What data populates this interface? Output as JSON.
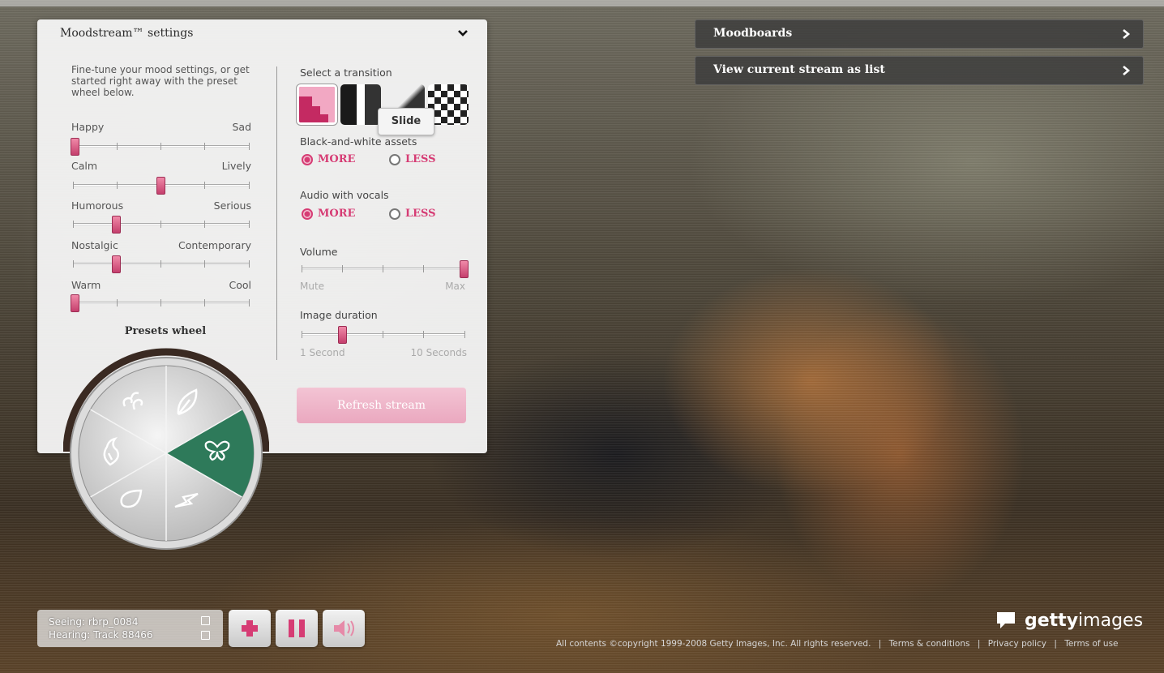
{
  "panel": {
    "title": "Moodstream™ settings",
    "intro": "Fine-tune your mood settings, or get started right away with the preset wheel below.",
    "sliders": [
      {
        "left": "Happy",
        "right": "Sad",
        "value": 0
      },
      {
        "left": "Calm",
        "right": "Lively",
        "value": 0.5
      },
      {
        "left": "Humorous",
        "right": "Serious",
        "value": 0.25
      },
      {
        "left": "Nostalgic",
        "right": "Contemporary",
        "value": 0.25
      },
      {
        "left": "Warm",
        "right": "Cool",
        "value": 0
      }
    ],
    "presets_title": "Presets wheel",
    "transition_label": "Select a transition",
    "transition_tooltip": "Slide",
    "bw_label": "Black-and-white assets",
    "audio_label": "Audio with vocals",
    "more_label": "MORE",
    "less_label": "LESS",
    "volume_label": "Volume",
    "volume_min": "Mute",
    "volume_max": "Max",
    "volume_value": 1,
    "duration_label": "Image duration",
    "duration_min": "1 Second",
    "duration_max": "10 Seconds",
    "duration_value": 0.25,
    "refresh_label": "Refresh stream"
  },
  "menu": {
    "moodboards": "Moodboards",
    "view_list": "View current stream as list"
  },
  "status": {
    "seeing_label": "Seeing:",
    "seeing_value": "rbrp_0084",
    "hearing_label": "Hearing:",
    "hearing_value": "Track 88466"
  },
  "brand": {
    "logo_bold": "getty",
    "logo_light": "images"
  },
  "footer": {
    "copyright": "All contents ©copyright 1999-2008 Getty Images, Inc. All rights reserved.",
    "terms_conditions": "Terms & conditions",
    "privacy": "Privacy policy",
    "terms_use": "Terms of use"
  },
  "colors": {
    "accent": "#d63c74",
    "wheel_selected": "#2e7a5a"
  }
}
